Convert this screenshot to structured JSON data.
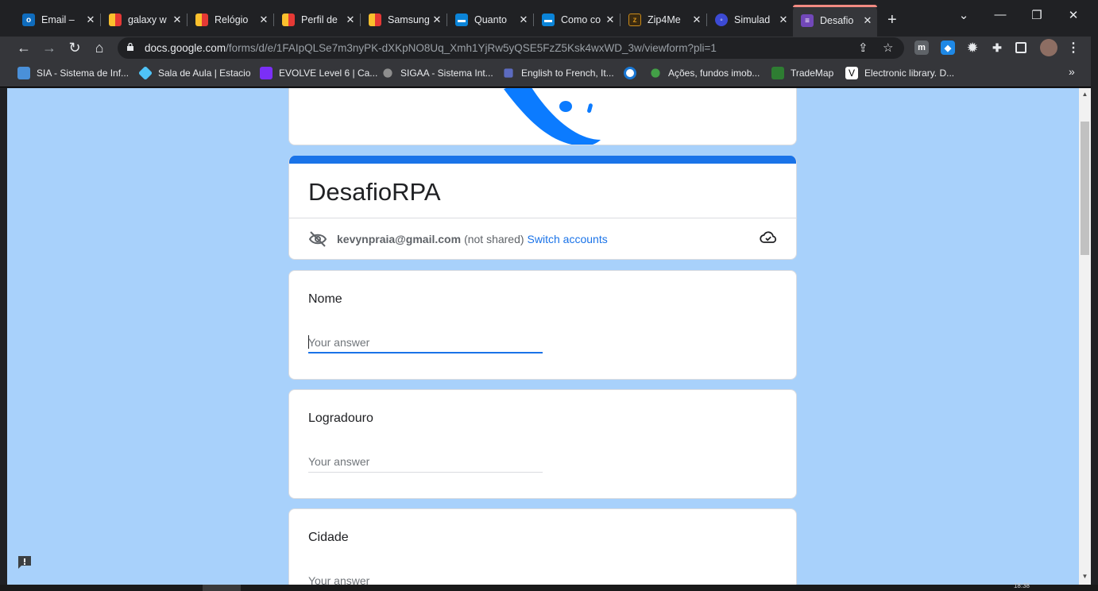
{
  "browser": {
    "tabs": [
      {
        "title": "Email – ",
        "icon": "outlook-icon",
        "color": "#0f6cbd"
      },
      {
        "title": "galaxy w",
        "icon": "store-icon",
        "color": "#e53935"
      },
      {
        "title": "Relógio",
        "icon": "store-icon",
        "color": "#e53935"
      },
      {
        "title": "Perfil de",
        "icon": "store-icon",
        "color": "#e53935"
      },
      {
        "title": "Samsung",
        "icon": "store-icon",
        "color": "#e53935"
      },
      {
        "title": "Quanto",
        "icon": "meet-icon",
        "color": "#0b84d8"
      },
      {
        "title": "Como co",
        "icon": "meet-icon",
        "color": "#0b84d8"
      },
      {
        "title": "Zip4Me",
        "icon": "zip-icon",
        "color": "#c98a1a"
      },
      {
        "title": "Simulad",
        "icon": "sim-icon",
        "color": "#3c4ad4"
      },
      {
        "title": "Desafio",
        "icon": "forms-icon",
        "color": "#7248b9"
      }
    ],
    "url_host": "docs.google.com",
    "url_path": "/forms/d/e/1FAIpQLSe7m3nyPK-dXKpNO8Uq_Xmh1YjRw5yQSE5FzZ5Ksk4wxWD_3w/viewform?pli=1",
    "bookmarks": [
      {
        "label": "SIA - Sistema de Inf...",
        "color": "#4a90d9"
      },
      {
        "label": "Sala de Aula | Estacio",
        "color": "#4fc3f7"
      },
      {
        "label": "EVOLVE Level 6 | Ca...",
        "color": "#7b2ff7"
      },
      {
        "label": "SIGAA - Sistema Int...",
        "color": "#8e8e8e"
      },
      {
        "label": "English to French, It...",
        "color": "#5c6bc0"
      },
      {
        "label": "",
        "color": "#1976d2"
      },
      {
        "label": "Ações, fundos imob...",
        "color": "#43a047"
      },
      {
        "label": "TradeMap",
        "color": "#2e7d32"
      },
      {
        "label": "Electronic library. D...",
        "color": "#ffffff"
      }
    ],
    "bookmarks_more": "»",
    "clock": "18:38"
  },
  "form": {
    "title": "DesafioRPA",
    "account_email": "kevynpraia@gmail.com",
    "not_shared": "(not shared)",
    "switch_accounts": "Switch accounts",
    "questions": [
      {
        "label": "Nome",
        "placeholder": "Your answer"
      },
      {
        "label": "Logradouro",
        "placeholder": "Your answer"
      },
      {
        "label": "Cidade",
        "placeholder": "Your answer"
      }
    ]
  },
  "colors": {
    "accent": "#1a73e8",
    "page_bg": "#a8d1fb",
    "header_blue": "#0b7bff"
  }
}
